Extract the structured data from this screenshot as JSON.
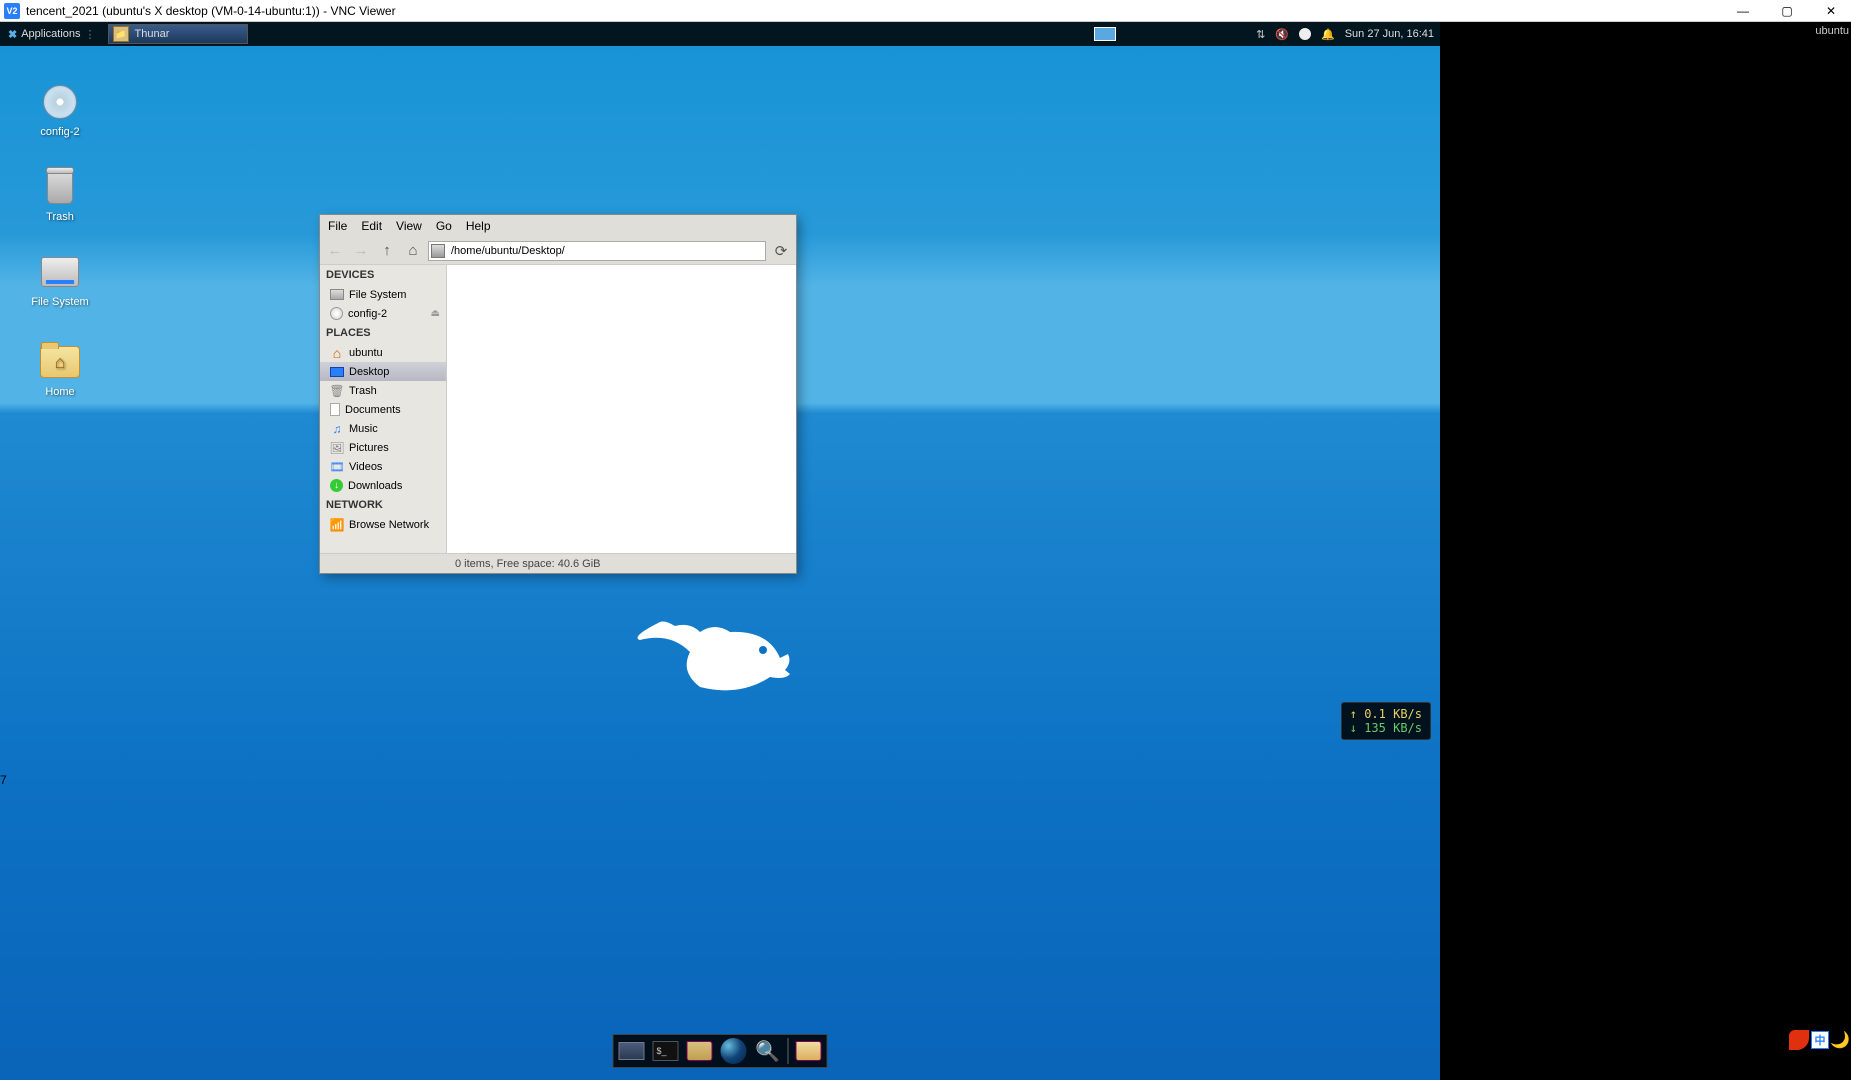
{
  "vnc": {
    "title": "tencent_2021 (ubuntu's X desktop (VM-0-14-ubuntu:1)) - VNC Viewer"
  },
  "panel": {
    "applications": "Applications",
    "task": "Thunar",
    "clock": "Sun 27 Jun, 16:41",
    "session": "ubuntu"
  },
  "desktop_icons": {
    "config": "config-2",
    "trash": "Trash",
    "filesystem": "File System",
    "home": "Home"
  },
  "thunar": {
    "menu": {
      "file": "File",
      "edit": "Edit",
      "view": "View",
      "go": "Go",
      "help": "Help"
    },
    "path": "/home/ubuntu/Desktop/",
    "side": {
      "devices_hdr": "DEVICES",
      "filesystem": "File System",
      "config": "config-2",
      "places_hdr": "PLACES",
      "ubuntu": "ubuntu",
      "desktop": "Desktop",
      "trash": "Trash",
      "documents": "Documents",
      "music": "Music",
      "pictures": "Pictures",
      "videos": "Videos",
      "downloads": "Downloads",
      "network_hdr": "NETWORK",
      "browse": "Browse Network"
    },
    "status": "0 items, Free space: 40.6 GiB"
  },
  "netmon": {
    "up": "↑ 0.1 KB/s",
    "down": "↓ 135 KB/s"
  },
  "ime": {
    "zhong": "中"
  },
  "stray": {
    "seven": "7"
  }
}
